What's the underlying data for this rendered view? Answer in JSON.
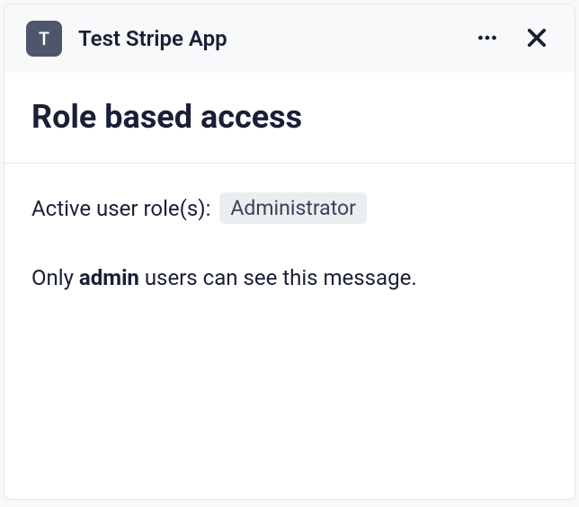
{
  "header": {
    "app_icon_letter": "T",
    "app_title": "Test Stripe App"
  },
  "page": {
    "title": "Role based access"
  },
  "content": {
    "role_label": "Active user role(s):",
    "role_value": "Administrator",
    "message_prefix": "Only ",
    "message_bold": "admin",
    "message_suffix": " users can see this message."
  }
}
